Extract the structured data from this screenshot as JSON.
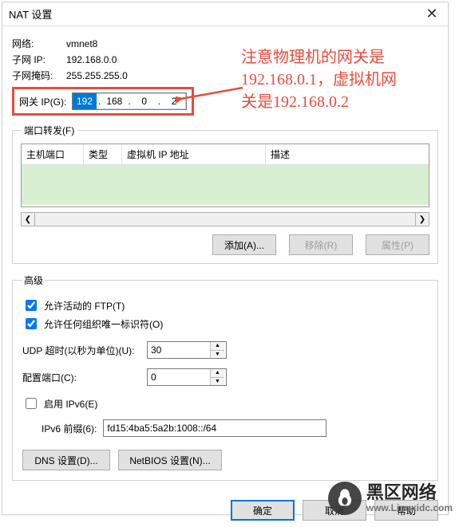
{
  "title": "NAT 设置",
  "network": {
    "label": "网络:",
    "value": "vmnet8"
  },
  "subnet_ip": {
    "label": "子网 IP:",
    "value": "192.168.0.0"
  },
  "subnet_mask": {
    "label": "子网掩码:",
    "value": "255.255.255.0"
  },
  "gateway": {
    "label": "网关 IP(G):",
    "oct1": "192",
    "oct2": "168",
    "oct3": "0",
    "oct4": "2"
  },
  "port_forwarding": {
    "legend": "端口转发(F)",
    "columns": {
      "host_port": "主机端口",
      "type": "类型",
      "vm_ip": "虚拟机 IP 地址",
      "desc": "描述"
    },
    "buttons": {
      "add": "添加(A)...",
      "remove": "移除(R)",
      "props": "属性(P)"
    }
  },
  "advanced": {
    "legend": "高级",
    "allow_active_ftp": "允许活动的 FTP(T)",
    "allow_any_oui": "允许任何组织唯一标识符(O)",
    "udp_timeout_label": "UDP 超时(以秒为单位)(U):",
    "udp_timeout_value": "30",
    "config_port_label": "配置端口(C):",
    "config_port_value": "0",
    "enable_ipv6_label": "启用 IPv6(E)",
    "ipv6_prefix_label": "IPv6 前缀(6):",
    "ipv6_prefix_value": "fd15:4ba5:5a2b:1008::/64",
    "dns_settings": "DNS 设置(D)...",
    "netbios_settings": "NetBIOS 设置(N)..."
  },
  "footer": {
    "ok": "确定",
    "cancel": "取消",
    "help": "帮助"
  },
  "annotation": "注意物理机的网关是\n192.168.0.1，虚拟机网\n关是192.168.0.2",
  "watermark": {
    "name": "黑区网络",
    "url": "www.Linuxidc.com"
  }
}
